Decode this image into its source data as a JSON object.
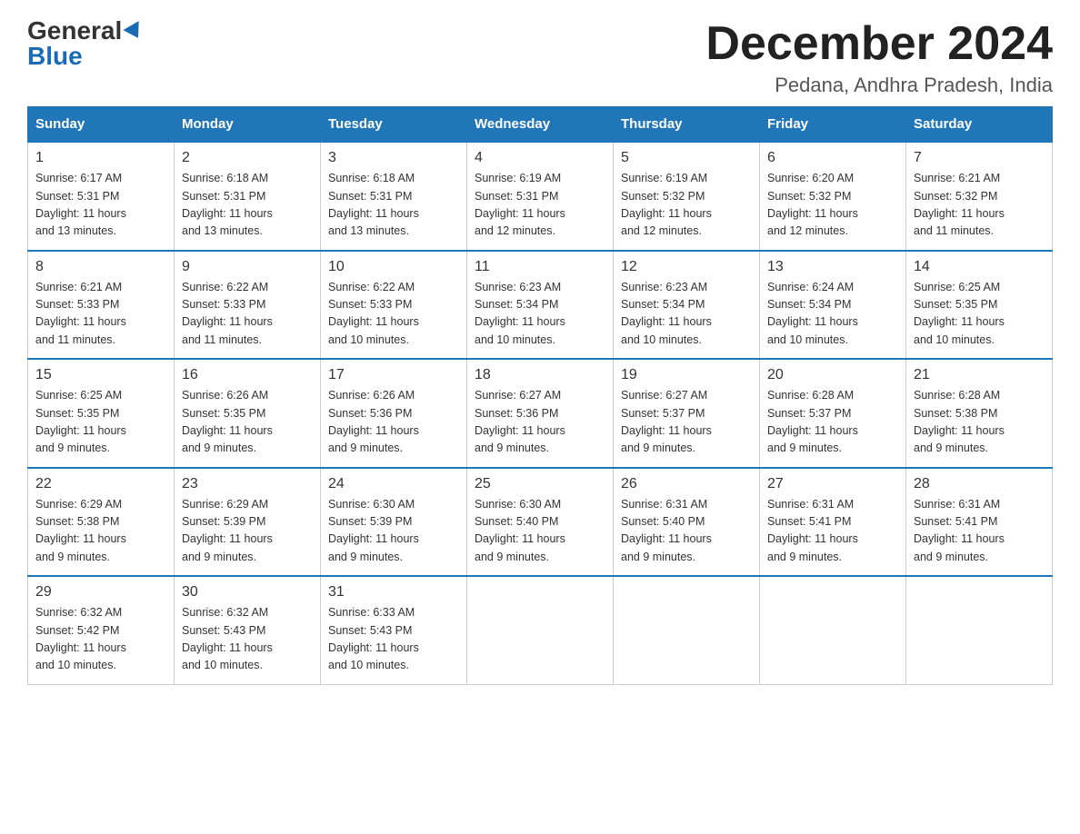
{
  "header": {
    "logo_general": "General",
    "logo_blue": "Blue",
    "month_title": "December 2024",
    "location": "Pedana, Andhra Pradesh, India"
  },
  "days_of_week": [
    "Sunday",
    "Monday",
    "Tuesday",
    "Wednesday",
    "Thursday",
    "Friday",
    "Saturday"
  ],
  "weeks": [
    [
      {
        "day": "1",
        "sunrise": "6:17 AM",
        "sunset": "5:31 PM",
        "daylight": "11 hours and 13 minutes."
      },
      {
        "day": "2",
        "sunrise": "6:18 AM",
        "sunset": "5:31 PM",
        "daylight": "11 hours and 13 minutes."
      },
      {
        "day": "3",
        "sunrise": "6:18 AM",
        "sunset": "5:31 PM",
        "daylight": "11 hours and 13 minutes."
      },
      {
        "day": "4",
        "sunrise": "6:19 AM",
        "sunset": "5:31 PM",
        "daylight": "11 hours and 12 minutes."
      },
      {
        "day": "5",
        "sunrise": "6:19 AM",
        "sunset": "5:32 PM",
        "daylight": "11 hours and 12 minutes."
      },
      {
        "day": "6",
        "sunrise": "6:20 AM",
        "sunset": "5:32 PM",
        "daylight": "11 hours and 12 minutes."
      },
      {
        "day": "7",
        "sunrise": "6:21 AM",
        "sunset": "5:32 PM",
        "daylight": "11 hours and 11 minutes."
      }
    ],
    [
      {
        "day": "8",
        "sunrise": "6:21 AM",
        "sunset": "5:33 PM",
        "daylight": "11 hours and 11 minutes."
      },
      {
        "day": "9",
        "sunrise": "6:22 AM",
        "sunset": "5:33 PM",
        "daylight": "11 hours and 11 minutes."
      },
      {
        "day": "10",
        "sunrise": "6:22 AM",
        "sunset": "5:33 PM",
        "daylight": "11 hours and 10 minutes."
      },
      {
        "day": "11",
        "sunrise": "6:23 AM",
        "sunset": "5:34 PM",
        "daylight": "11 hours and 10 minutes."
      },
      {
        "day": "12",
        "sunrise": "6:23 AM",
        "sunset": "5:34 PM",
        "daylight": "11 hours and 10 minutes."
      },
      {
        "day": "13",
        "sunrise": "6:24 AM",
        "sunset": "5:34 PM",
        "daylight": "11 hours and 10 minutes."
      },
      {
        "day": "14",
        "sunrise": "6:25 AM",
        "sunset": "5:35 PM",
        "daylight": "11 hours and 10 minutes."
      }
    ],
    [
      {
        "day": "15",
        "sunrise": "6:25 AM",
        "sunset": "5:35 PM",
        "daylight": "11 hours and 9 minutes."
      },
      {
        "day": "16",
        "sunrise": "6:26 AM",
        "sunset": "5:35 PM",
        "daylight": "11 hours and 9 minutes."
      },
      {
        "day": "17",
        "sunrise": "6:26 AM",
        "sunset": "5:36 PM",
        "daylight": "11 hours and 9 minutes."
      },
      {
        "day": "18",
        "sunrise": "6:27 AM",
        "sunset": "5:36 PM",
        "daylight": "11 hours and 9 minutes."
      },
      {
        "day": "19",
        "sunrise": "6:27 AM",
        "sunset": "5:37 PM",
        "daylight": "11 hours and 9 minutes."
      },
      {
        "day": "20",
        "sunrise": "6:28 AM",
        "sunset": "5:37 PM",
        "daylight": "11 hours and 9 minutes."
      },
      {
        "day": "21",
        "sunrise": "6:28 AM",
        "sunset": "5:38 PM",
        "daylight": "11 hours and 9 minutes."
      }
    ],
    [
      {
        "day": "22",
        "sunrise": "6:29 AM",
        "sunset": "5:38 PM",
        "daylight": "11 hours and 9 minutes."
      },
      {
        "day": "23",
        "sunrise": "6:29 AM",
        "sunset": "5:39 PM",
        "daylight": "11 hours and 9 minutes."
      },
      {
        "day": "24",
        "sunrise": "6:30 AM",
        "sunset": "5:39 PM",
        "daylight": "11 hours and 9 minutes."
      },
      {
        "day": "25",
        "sunrise": "6:30 AM",
        "sunset": "5:40 PM",
        "daylight": "11 hours and 9 minutes."
      },
      {
        "day": "26",
        "sunrise": "6:31 AM",
        "sunset": "5:40 PM",
        "daylight": "11 hours and 9 minutes."
      },
      {
        "day": "27",
        "sunrise": "6:31 AM",
        "sunset": "5:41 PM",
        "daylight": "11 hours and 9 minutes."
      },
      {
        "day": "28",
        "sunrise": "6:31 AM",
        "sunset": "5:41 PM",
        "daylight": "11 hours and 9 minutes."
      }
    ],
    [
      {
        "day": "29",
        "sunrise": "6:32 AM",
        "sunset": "5:42 PM",
        "daylight": "11 hours and 10 minutes."
      },
      {
        "day": "30",
        "sunrise": "6:32 AM",
        "sunset": "5:43 PM",
        "daylight": "11 hours and 10 minutes."
      },
      {
        "day": "31",
        "sunrise": "6:33 AM",
        "sunset": "5:43 PM",
        "daylight": "11 hours and 10 minutes."
      },
      null,
      null,
      null,
      null
    ]
  ],
  "labels": {
    "sunrise": "Sunrise:",
    "sunset": "Sunset:",
    "daylight": "Daylight:"
  }
}
